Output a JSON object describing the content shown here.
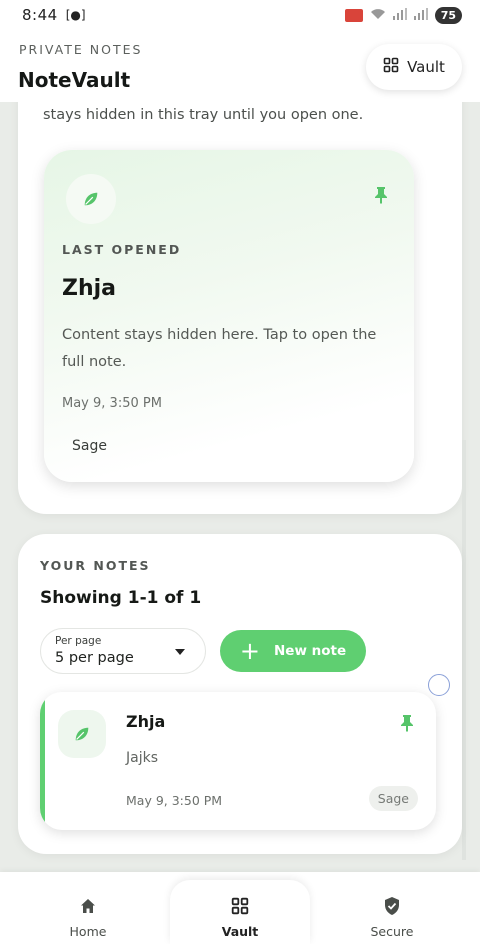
{
  "status_bar": {
    "time": "8:44",
    "battery": "75"
  },
  "header": {
    "eyebrow": "PRIVATE NOTES",
    "title": "NoteVault",
    "vault_button": "Vault"
  },
  "tray": {
    "cut_text": "stays hidden in this tray until you open one.",
    "featured": {
      "eyebrow": "LAST OPENED",
      "title": "Zhja",
      "preview": "Content stays hidden here. Tap to open the full note.",
      "date": "May 9, 3:50 PM",
      "tag": "Sage"
    }
  },
  "notes": {
    "eyebrow": "YOUR NOTES",
    "showing": "Showing 1-1 of 1",
    "per_page_label": "Per page",
    "per_page_value": "5 per page",
    "new_note": "New note",
    "items": [
      {
        "title": "Zhja",
        "preview": "Jajks",
        "date": "May 9, 3:50 PM",
        "tag": "Sage"
      }
    ]
  },
  "nav": {
    "home": "Home",
    "vault": "Vault",
    "secure": "Secure"
  },
  "colors": {
    "accent": "#5fcf71",
    "leaf": "#56c46a"
  }
}
